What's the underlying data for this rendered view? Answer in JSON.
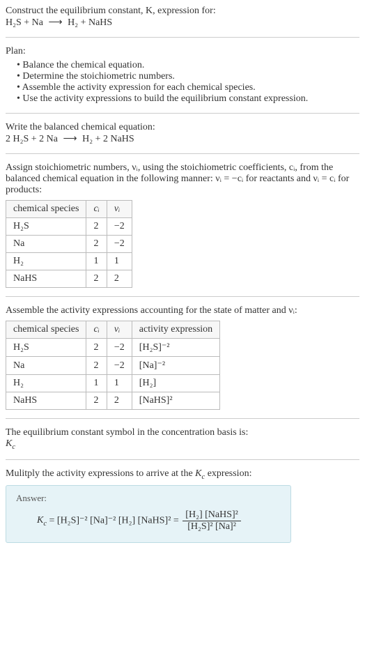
{
  "prompt": {
    "line1": "Construct the equilibrium constant, K, expression for:",
    "eq_l": "H₂S + Na",
    "eq_arrow": "⟶",
    "eq_r": "H₂ + NaHS"
  },
  "plan": {
    "title": "Plan:",
    "items": [
      "Balance the chemical equation.",
      "Determine the stoichiometric numbers.",
      "Assemble the activity expression for each chemical species.",
      "Use the activity expressions to build the equilibrium constant expression."
    ]
  },
  "balanced": {
    "intro": "Write the balanced chemical equation:",
    "eq_l": "2 H₂S + 2 Na",
    "eq_arrow": "⟶",
    "eq_r": "H₂ + 2 NaHS"
  },
  "stoich": {
    "intro_a": "Assign stoichiometric numbers, νᵢ, using the stoichiometric coefficients, cᵢ, from the balanced chemical equation in the following manner: νᵢ = −cᵢ for reactants and νᵢ = cᵢ for products:",
    "headers": {
      "species": "chemical species",
      "ci": "cᵢ",
      "vi": "νᵢ"
    },
    "rows": [
      {
        "species": "H₂S",
        "ci": "2",
        "vi": "−2"
      },
      {
        "species": "Na",
        "ci": "2",
        "vi": "−2"
      },
      {
        "species": "H₂",
        "ci": "1",
        "vi": "1"
      },
      {
        "species": "NaHS",
        "ci": "2",
        "vi": "2"
      }
    ]
  },
  "activity": {
    "intro": "Assemble the activity expressions accounting for the state of matter and νᵢ:",
    "headers": {
      "species": "chemical species",
      "ci": "cᵢ",
      "vi": "νᵢ",
      "act": "activity expression"
    },
    "rows": [
      {
        "species": "H₂S",
        "ci": "2",
        "vi": "−2",
        "act": "[H₂S]⁻²"
      },
      {
        "species": "Na",
        "ci": "2",
        "vi": "−2",
        "act": "[Na]⁻²"
      },
      {
        "species": "H₂",
        "ci": "1",
        "vi": "1",
        "act": "[H₂]"
      },
      {
        "species": "NaHS",
        "ci": "2",
        "vi": "2",
        "act": "[NaHS]²"
      }
    ]
  },
  "symbol": {
    "line1": "The equilibrium constant symbol in the concentration basis is:",
    "line2": "K_c"
  },
  "multiply": {
    "intro": "Mulitply the activity expressions to arrive at the K_c expression:"
  },
  "answer": {
    "label": "Answer:",
    "kc": "K_c",
    "rhs1": "= [H₂S]⁻² [Na]⁻² [H₂] [NaHS]² =",
    "num": "[H₂] [NaHS]²",
    "den": "[H₂S]² [Na]²"
  },
  "chart_data": {
    "type": "table",
    "tables": [
      {
        "title": "stoichiometric numbers",
        "columns": [
          "chemical species",
          "c_i",
          "ν_i"
        ],
        "rows": [
          [
            "H2S",
            2,
            -2
          ],
          [
            "Na",
            2,
            -2
          ],
          [
            "H2",
            1,
            1
          ],
          [
            "NaHS",
            2,
            2
          ]
        ]
      },
      {
        "title": "activity expressions",
        "columns": [
          "chemical species",
          "c_i",
          "ν_i",
          "activity expression"
        ],
        "rows": [
          [
            "H2S",
            2,
            -2,
            "[H2S]^-2"
          ],
          [
            "Na",
            2,
            -2,
            "[Na]^-2"
          ],
          [
            "H2",
            1,
            1,
            "[H2]"
          ],
          [
            "NaHS",
            2,
            2,
            "[NaHS]^2"
          ]
        ]
      }
    ],
    "equations": {
      "unbalanced": "H2S + Na -> H2 + NaHS",
      "balanced": "2 H2S + 2 Na -> H2 + 2 NaHS",
      "Kc": "[H2][NaHS]^2 / ([H2S]^2 [Na]^2)"
    }
  }
}
